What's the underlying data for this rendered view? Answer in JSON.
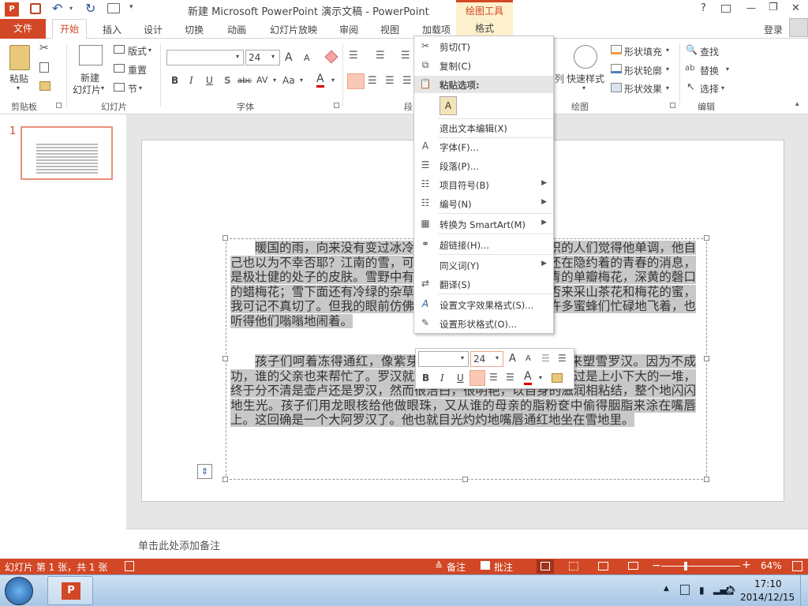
{
  "window": {
    "title": "新建 Microsoft PowerPoint 演示文稿 - PowerPoint",
    "help": "?",
    "min": "—",
    "max": "❐",
    "close": "✕"
  },
  "context_tool": {
    "group": "绘图工具",
    "tab": "格式"
  },
  "tabs": {
    "file": "文件",
    "home": "开始",
    "insert": "插入",
    "design": "设计",
    "transitions": "切换",
    "animations": "动画",
    "slideshow": "幻灯片放映",
    "review": "审阅",
    "view": "视图",
    "addins": "加载项"
  },
  "login": "登录",
  "ribbon": {
    "clipboard": {
      "paste": "粘贴",
      "label": "剪贴板"
    },
    "slides": {
      "new": "新建",
      "new2": "幻灯片",
      "layout": "版式",
      "reset": "重置",
      "section": "节",
      "label": "幻灯片"
    },
    "font": {
      "size": "24",
      "label": "字体",
      "b": "B",
      "i": "I",
      "u": "U",
      "s": "S",
      "abc": "abc",
      "av": "AV",
      "aa": "Aa",
      "a": "A",
      "grow": "A",
      "shrink": "A"
    },
    "paragraph": {
      "label": "段"
    },
    "drawing": {
      "fill": "形状填充",
      "outline": "形状轮廓",
      "effect": "形状效果",
      "quick": "快速样式",
      "label": "绘图"
    },
    "editing": {
      "find": "查找",
      "replace": "替换",
      "select": "选择",
      "label": "编辑"
    }
  },
  "slide_number": "1",
  "slide_text": {
    "p1": "暖国的雨，向来没有变过冰冷的坚硬的灿烂的雪花。博识的人们觉得他单调，他自己也以为不幸否耶？江南的雪，可是滋润美艳之至了；那是还在隐约着的青春的消息，是极壮健的处子的皮肤。雪野中有血红的宝珠山茶，白中隐青的单瓣梅花，深黄的磬口的蜡梅花；雪下面还有冷绿的杂草。蝴蝶确乎没有；蜜蜂是否来采山茶花和梅花的蜜，我可记不真切了。但我的眼前仿佛看见冬花开在雪野中，有许多蜜蜂们忙碌地飞着，也听得他们嗡嗡地闹着。",
    "p2": "孩子们呵着冻得通红，像紫芽姜一般的小手，七八个一齐来塑雪罗汉。因为不成功，谁的父亲也来帮忙了。罗汉就塑得比孩子们高得多，虽然不过是上小下大的一堆，终于分不清是壶卢还是罗汉，然而很洁白，很明艳，以自身的滋润相粘结，整个地闪闪地生光。孩子们用龙眼核给他做眼珠，又从谁的母亲的脂粉奁中偷得胭脂来涂在嘴唇上。这回确是一个大阿罗汉了。他也就目光灼灼地嘴唇通红地坐在雪地里。"
  },
  "context_menu": {
    "cut": "剪切(T)",
    "copy": "复制(C)",
    "paste_options": "粘贴选项:",
    "exit_edit": "退出文本编辑(X)",
    "font": "字体(F)...",
    "paragraph": "段落(P)...",
    "bullets": "项目符号(B)",
    "numbering": "编号(N)",
    "smartart": "转换为 SmartArt(M)",
    "hyperlink": "超链接(H)...",
    "synonyms": "同义词(Y)",
    "translate": "翻译(S)",
    "text_effects": "设置文字效果格式(S)...",
    "shape_format": "设置形状格式(O)..."
  },
  "mini_toolbar": {
    "size": "24",
    "b": "B",
    "i": "I",
    "u": "U",
    "a": "A"
  },
  "notes_placeholder": "单击此处添加备注",
  "status": {
    "slide_info": "幻灯片 第 1 张，共 1 张",
    "notes": "备注",
    "comments": "批注",
    "zoom": "64%"
  },
  "taskbar": {
    "time": "17:10",
    "date": "2014/12/15"
  },
  "colors": {
    "accent": "#d24726",
    "ctx_tab": "#fdf0cc"
  }
}
